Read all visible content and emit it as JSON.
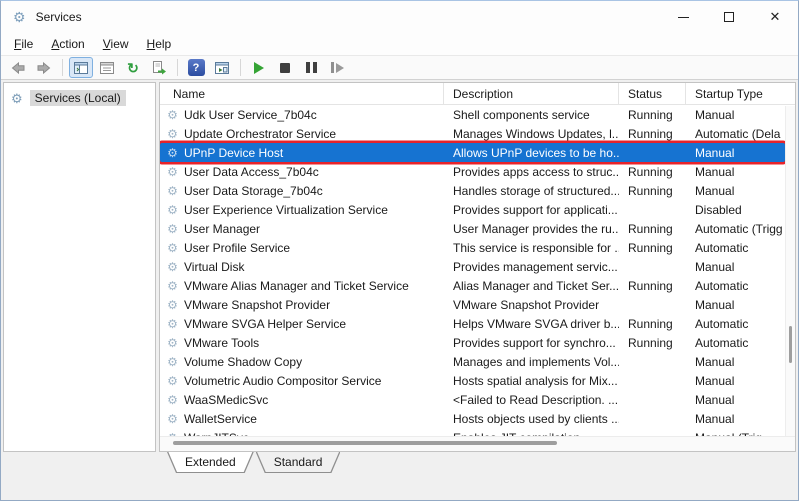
{
  "window": {
    "title": "Services",
    "controls": {
      "close_glyph": "✕"
    }
  },
  "menu": {
    "items": [
      {
        "label": "File"
      },
      {
        "label": "Action"
      },
      {
        "label": "View"
      },
      {
        "label": "Help"
      }
    ]
  },
  "toolbar": {
    "buttons": [
      "back",
      "forward",
      "show-console-tree",
      "properties",
      "refresh",
      "export-list",
      "help",
      "show-action-pane",
      "start-service",
      "stop-service",
      "pause-service",
      "restart-service"
    ],
    "refresh_glyph": "↻",
    "help_glyph": "?"
  },
  "sidebar": {
    "root_label": "Services (Local)"
  },
  "list": {
    "columns": [
      {
        "label": "Name"
      },
      {
        "label": "Description"
      },
      {
        "label": "Status"
      },
      {
        "label": "Startup Type"
      }
    ],
    "selected_index": 2,
    "rows": [
      {
        "name": "Udk User Service_7b04c",
        "description": "Shell components service",
        "status": "Running",
        "startup": "Manual"
      },
      {
        "name": "Update Orchestrator Service",
        "description": "Manages Windows Updates, l...",
        "status": "Running",
        "startup": "Automatic (Dela"
      },
      {
        "name": "UPnP Device Host",
        "description": "Allows UPnP devices to be ho...",
        "status": "",
        "startup": "Manual"
      },
      {
        "name": "User Data Access_7b04c",
        "description": "Provides apps access to struc...",
        "status": "Running",
        "startup": "Manual"
      },
      {
        "name": "User Data Storage_7b04c",
        "description": "Handles storage of structured...",
        "status": "Running",
        "startup": "Manual"
      },
      {
        "name": "User Experience Virtualization Service",
        "description": "Provides support for applicati...",
        "status": "",
        "startup": "Disabled"
      },
      {
        "name": "User Manager",
        "description": "User Manager provides the ru...",
        "status": "Running",
        "startup": "Automatic (Trigg"
      },
      {
        "name": "User Profile Service",
        "description": "This service is responsible for ...",
        "status": "Running",
        "startup": "Automatic"
      },
      {
        "name": "Virtual Disk",
        "description": "Provides management servic...",
        "status": "",
        "startup": "Manual"
      },
      {
        "name": "VMware Alias Manager and Ticket Service",
        "description": "Alias Manager and Ticket Ser...",
        "status": "Running",
        "startup": "Automatic"
      },
      {
        "name": "VMware Snapshot Provider",
        "description": "VMware Snapshot Provider",
        "status": "",
        "startup": "Manual"
      },
      {
        "name": "VMware SVGA Helper Service",
        "description": "Helps VMware SVGA driver b...",
        "status": "Running",
        "startup": "Automatic"
      },
      {
        "name": "VMware Tools",
        "description": "Provides support for synchro...",
        "status": "Running",
        "startup": "Automatic"
      },
      {
        "name": "Volume Shadow Copy",
        "description": "Manages and implements Vol...",
        "status": "",
        "startup": "Manual"
      },
      {
        "name": "Volumetric Audio Compositor Service",
        "description": "Hosts spatial analysis for Mix...",
        "status": "",
        "startup": "Manual"
      },
      {
        "name": "WaaSMedicSvc",
        "description": "<Failed to Read Description. ...",
        "status": "",
        "startup": "Manual"
      },
      {
        "name": "WalletService",
        "description": "Hosts objects used by clients ...",
        "status": "",
        "startup": "Manual"
      },
      {
        "name": "WarpJITSvc",
        "description": "Enables JIT compilation ...",
        "status": "",
        "startup": "Manual (Trig"
      }
    ]
  },
  "tabs": [
    {
      "label": "Extended",
      "active": true
    },
    {
      "label": "Standard",
      "active": false
    }
  ],
  "colors": {
    "selection_bg": "#1673d1",
    "selection_callout_border": "#e8232a",
    "start_green": "#35a435",
    "help_blue": "#3a57a8",
    "window_bg": "#f0f0f0"
  }
}
